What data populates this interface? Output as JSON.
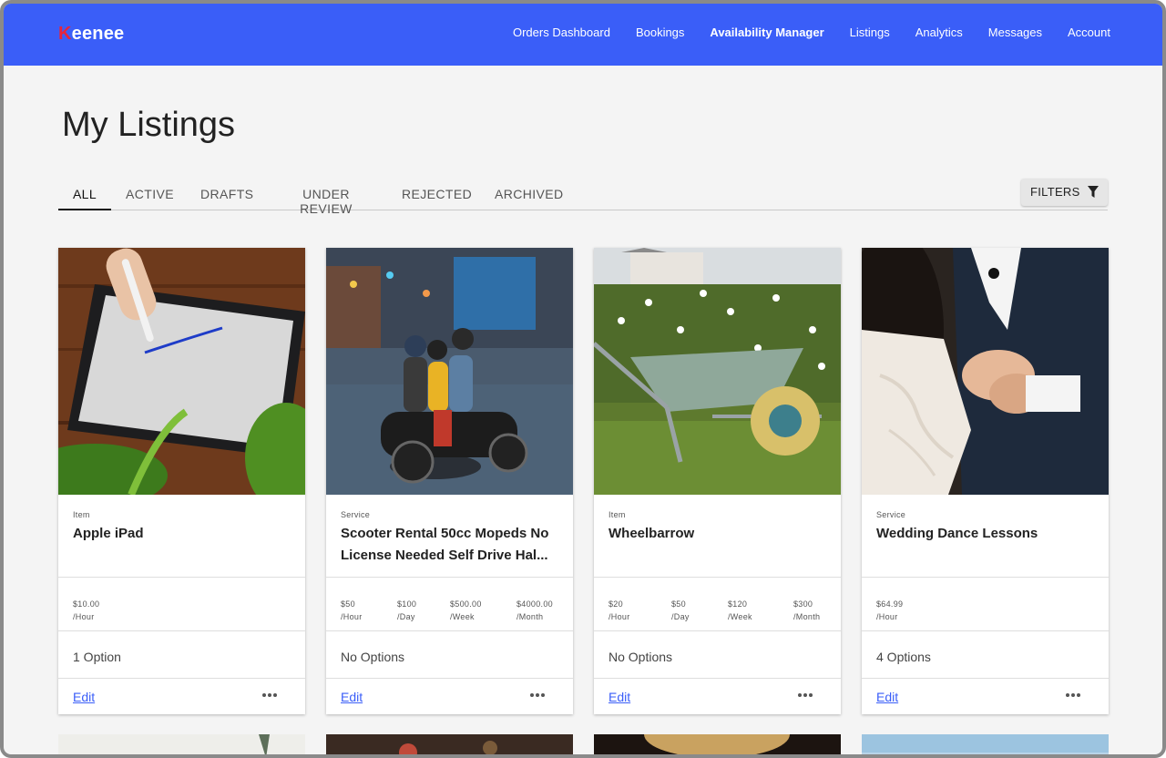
{
  "app": {
    "logo_mark": "K",
    "logo_rest": "eenee",
    "nav": [
      {
        "label": "Orders Dashboard",
        "active": false
      },
      {
        "label": "Bookings",
        "active": false
      },
      {
        "label": "Availability Manager",
        "active": true
      },
      {
        "label": "Listings",
        "active": false
      },
      {
        "label": "Analytics",
        "active": false
      },
      {
        "label": "Messages",
        "active": false
      },
      {
        "label": "Account",
        "active": false
      }
    ]
  },
  "page": {
    "title": "My Listings",
    "tabs": [
      {
        "label": "ALL",
        "active": true
      },
      {
        "label": "ACTIVE",
        "active": false
      },
      {
        "label": "DRAFTS",
        "active": false
      },
      {
        "label": "UNDER REVIEW",
        "active": false
      },
      {
        "label": "REJECTED",
        "active": false
      },
      {
        "label": "ARCHIVED",
        "active": false
      }
    ],
    "filters_label": "FILTERS",
    "filters_icon": "filter-icon"
  },
  "listings": [
    {
      "type": "Item",
      "name": "Apple iPad",
      "prices": [
        {
          "amount": "$10.00",
          "unit": "/Hour"
        }
      ],
      "options": "1 Option",
      "edit_label": "Edit",
      "image": "tablet-drawing-photo"
    },
    {
      "type": "Service",
      "name": "Scooter Rental 50cc Mopeds No License Needed Self Drive Hal...",
      "prices": [
        {
          "amount": "$50",
          "unit": "/Hour"
        },
        {
          "amount": "$100",
          "unit": "/Day"
        },
        {
          "amount": "$500.00",
          "unit": "/Week"
        },
        {
          "amount": "$4000.00",
          "unit": "/Month"
        }
      ],
      "options": "No Options",
      "edit_label": "Edit",
      "image": "scooter-street-photo"
    },
    {
      "type": "Item",
      "name": "Wheelbarrow",
      "prices": [
        {
          "amount": "$20",
          "unit": "/Hour"
        },
        {
          "amount": "$50",
          "unit": "/Day"
        },
        {
          "amount": "$120",
          "unit": "/Week"
        },
        {
          "amount": "$300",
          "unit": "/Month"
        }
      ],
      "options": "No Options",
      "edit_label": "Edit",
      "image": "wheelbarrow-garden-photo"
    },
    {
      "type": "Service",
      "name": "Wedding Dance Lessons",
      "prices": [
        {
          "amount": "$64.99",
          "unit": "/Hour"
        }
      ],
      "options": "4 Options",
      "edit_label": "Edit",
      "image": "wedding-couple-photo"
    }
  ],
  "colors": {
    "header_bg": "#3a5ef8",
    "link": "#3a5ef8",
    "logo_accent": "#e8243c"
  }
}
